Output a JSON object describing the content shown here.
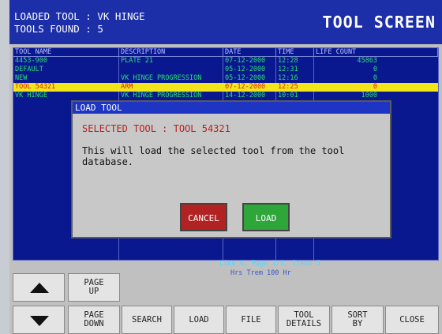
{
  "header": {
    "loaded_tool": "LOADED TOOL : VK HINGE",
    "tools_found": "TOOLS FOUND : 5",
    "title": "TOOL SCREEN"
  },
  "table": {
    "columns": [
      "TOOL NAME",
      "DESCRIPTION",
      "DATE",
      "TIME",
      "LIFE COUNT"
    ],
    "rows": [
      {
        "name": "4453-900",
        "desc": "PLATE 21",
        "date": "07-12-2000",
        "time": "12:28",
        "life": "45863"
      },
      {
        "name": "DEFAULT",
        "desc": "",
        "date": "05-12-2000",
        "time": "12:31",
        "life": "0"
      },
      {
        "name": "NEW",
        "desc": "VK HINGE PROGRESSION",
        "date": "05-12-2000",
        "time": "12:16",
        "life": "0"
      },
      {
        "name": "TOOL 54321",
        "desc": "ARM",
        "date": "07-12-2000",
        "time": "12:25",
        "life": "0"
      },
      {
        "name": "VK HINGE",
        "desc": "VK HINGE PROGRESSION",
        "date": "14-12-2000",
        "time": "10:01",
        "life": "1000"
      }
    ],
    "status": "Line 4, Page 1/1, Items 5",
    "status2": "Hrs Trem    100 Hr"
  },
  "dialog": {
    "title": "LOAD TOOL",
    "selected": "SELECTED TOOL : TOOL 54321",
    "message": "This will load the selected tool from the tool database.",
    "cancel": "CANCEL",
    "load": "LOAD"
  },
  "buttons": {
    "page_up": "PAGE\nUP",
    "page_down": "PAGE\nDOWN",
    "search": "SEARCH",
    "load": "LOAD",
    "file": "FILE",
    "tool_details": "TOOL\nDETAILS",
    "sort_by": "SORT\nBY",
    "close": "CLOSE"
  },
  "icons": {
    "up": "triangle-up-icon",
    "down": "triangle-down-icon"
  }
}
